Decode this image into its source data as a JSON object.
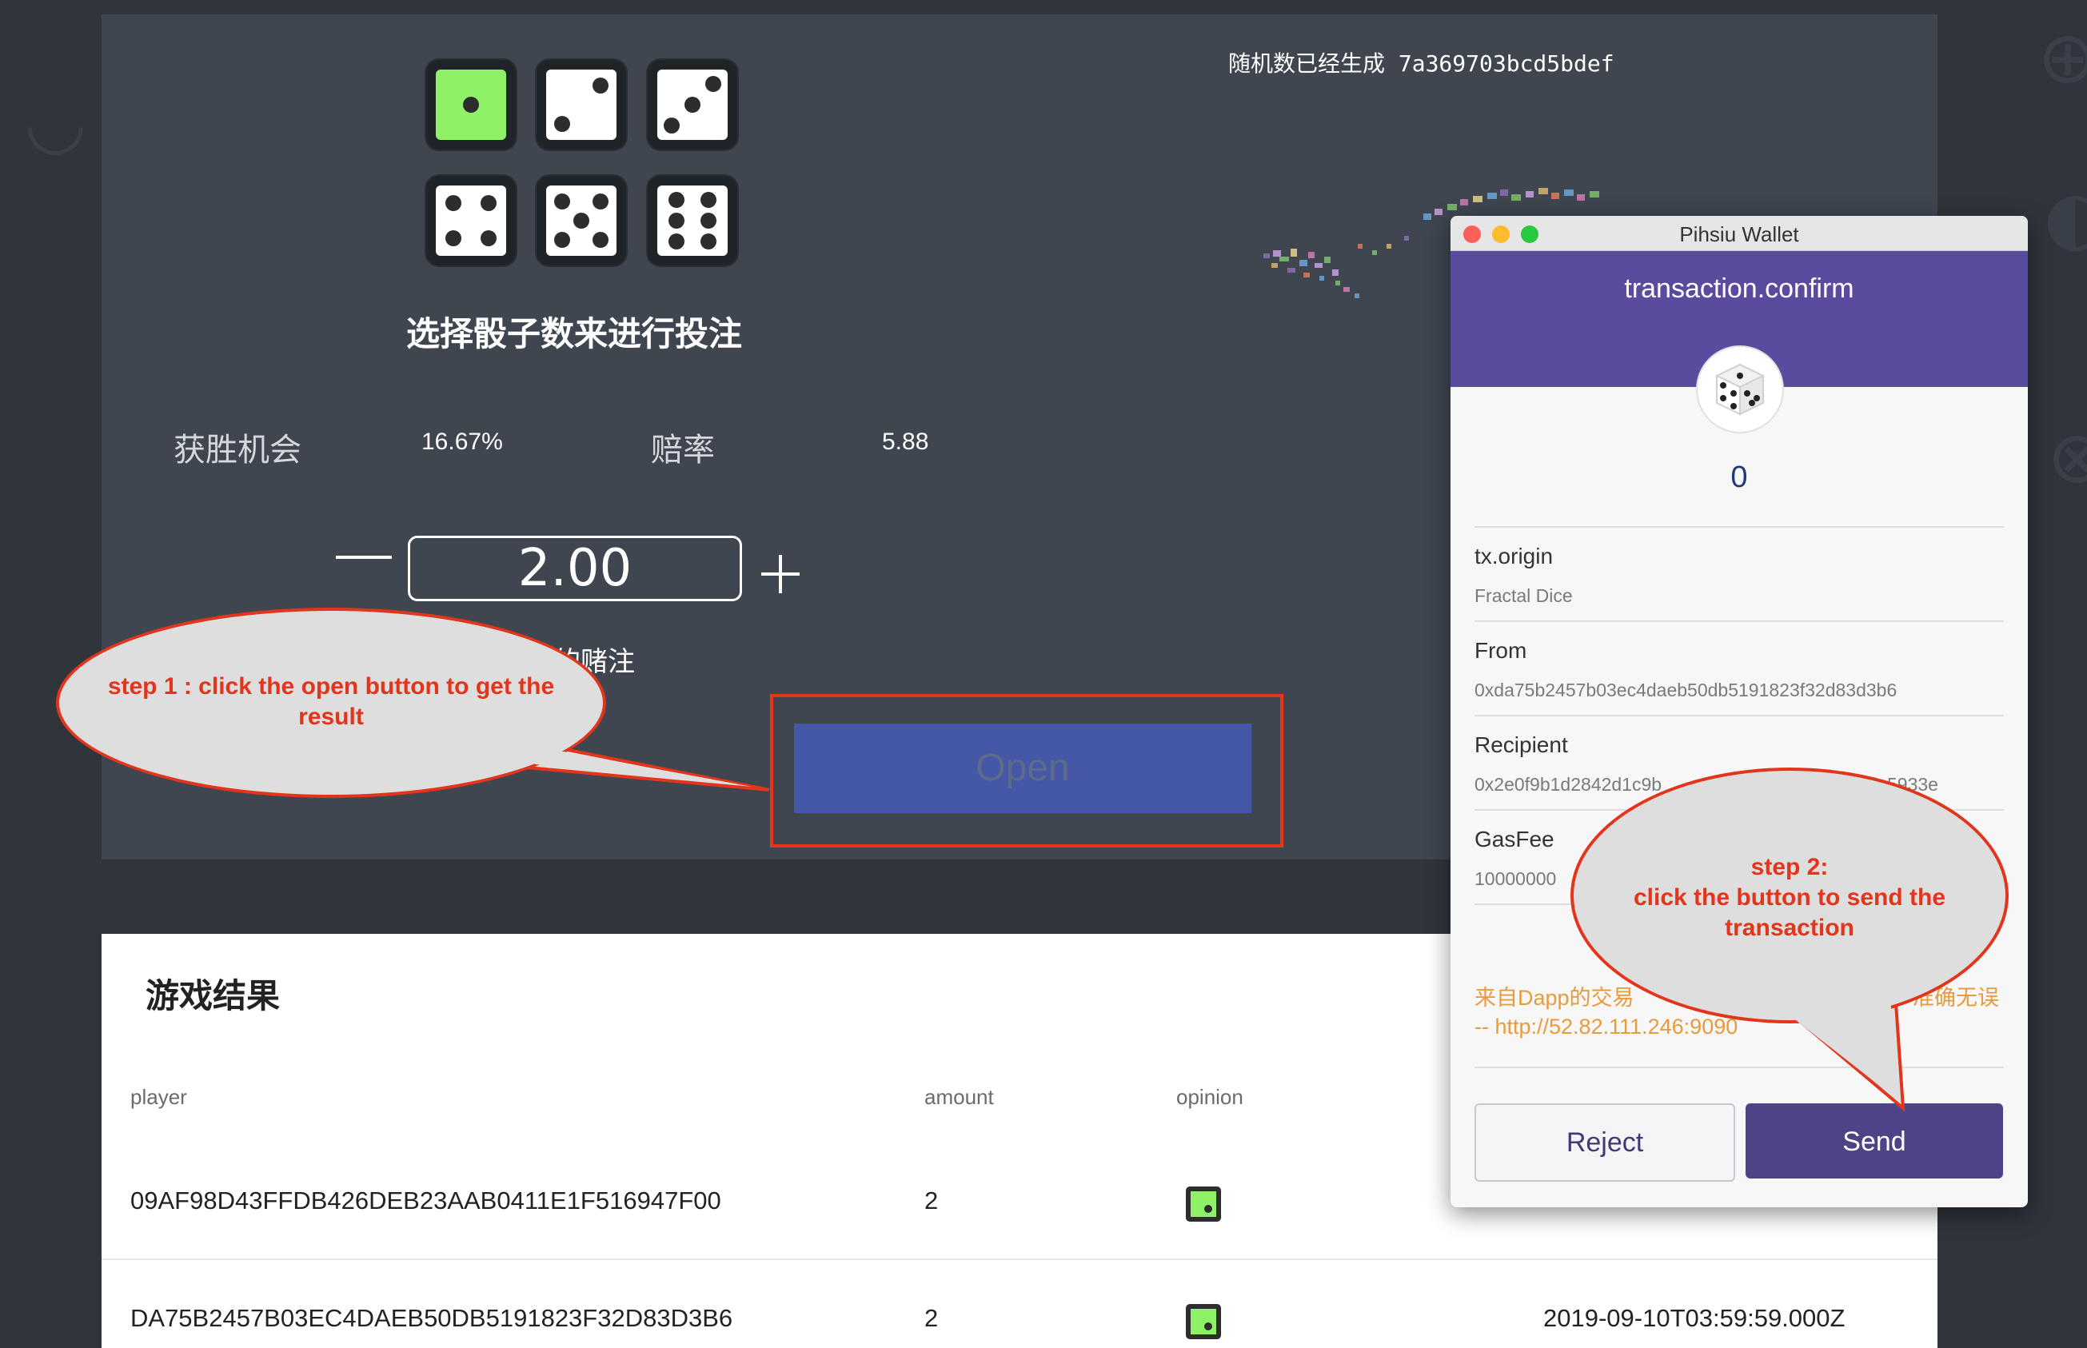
{
  "game": {
    "title": "选择骰子数来进行投注",
    "random_label": "随机数已经生成 7a369703bcd5bdef",
    "win_chance_label": "获胜机会",
    "win_chance_value": "16.67%",
    "odds_label": "赔率",
    "odds_value": "5.88",
    "bet_amount": "2.00",
    "bet_label_partial": "的赌注",
    "open_button": "Open",
    "selected_die": 1,
    "dice": [
      1,
      2,
      3,
      4,
      5,
      6
    ]
  },
  "callouts": {
    "step1": "step 1 : click the open button to get the result",
    "step2_line1": "step 2:",
    "step2_line2": "click the button to send the transaction"
  },
  "results": {
    "title": "游戏结果",
    "headers": [
      "player",
      "amount",
      "opinion"
    ],
    "rows": [
      {
        "player": "09AF98D43FFDB426DEB23AAB0411E1F516947F00",
        "amount": "2",
        "opinion_die": 1,
        "time": ""
      },
      {
        "player": "DA75B2457B03EC4DAEB50DB5191823F32D83D3B6",
        "amount": "2",
        "opinion_die": 1,
        "time": "2019-09-10T03:59:59.000Z"
      }
    ]
  },
  "wallet": {
    "window_title": "Pihsiu Wallet",
    "header_title": "transaction.confirm",
    "amount": "0",
    "fields": [
      {
        "label": "tx.origin",
        "value": "Fractal Dice"
      },
      {
        "label": "From",
        "value": "0xda75b2457b03ec4daeb50db5191823f32d83d3b6"
      },
      {
        "label": "Recipient",
        "value": "0x2e0f9b1d2842d1c9b",
        "value_tail": "5933e"
      },
      {
        "label": "GasFee",
        "value": "10000000"
      }
    ],
    "warning_line1_start": "来自Dapp的交易",
    "warning_line1_end": "准确无误",
    "warning_line2": "-- http://52.82.111.246:9090",
    "reject_button": "Reject",
    "send_button": "Send"
  },
  "colors": {
    "page_bg": "#30353c",
    "panel_bg": "#3f4650",
    "die_active": "#8ef166",
    "open_button": "#4458a7",
    "annotation_red": "#e2351b",
    "wallet_purple": "#5b4b9e",
    "send_button": "#4d4488"
  }
}
